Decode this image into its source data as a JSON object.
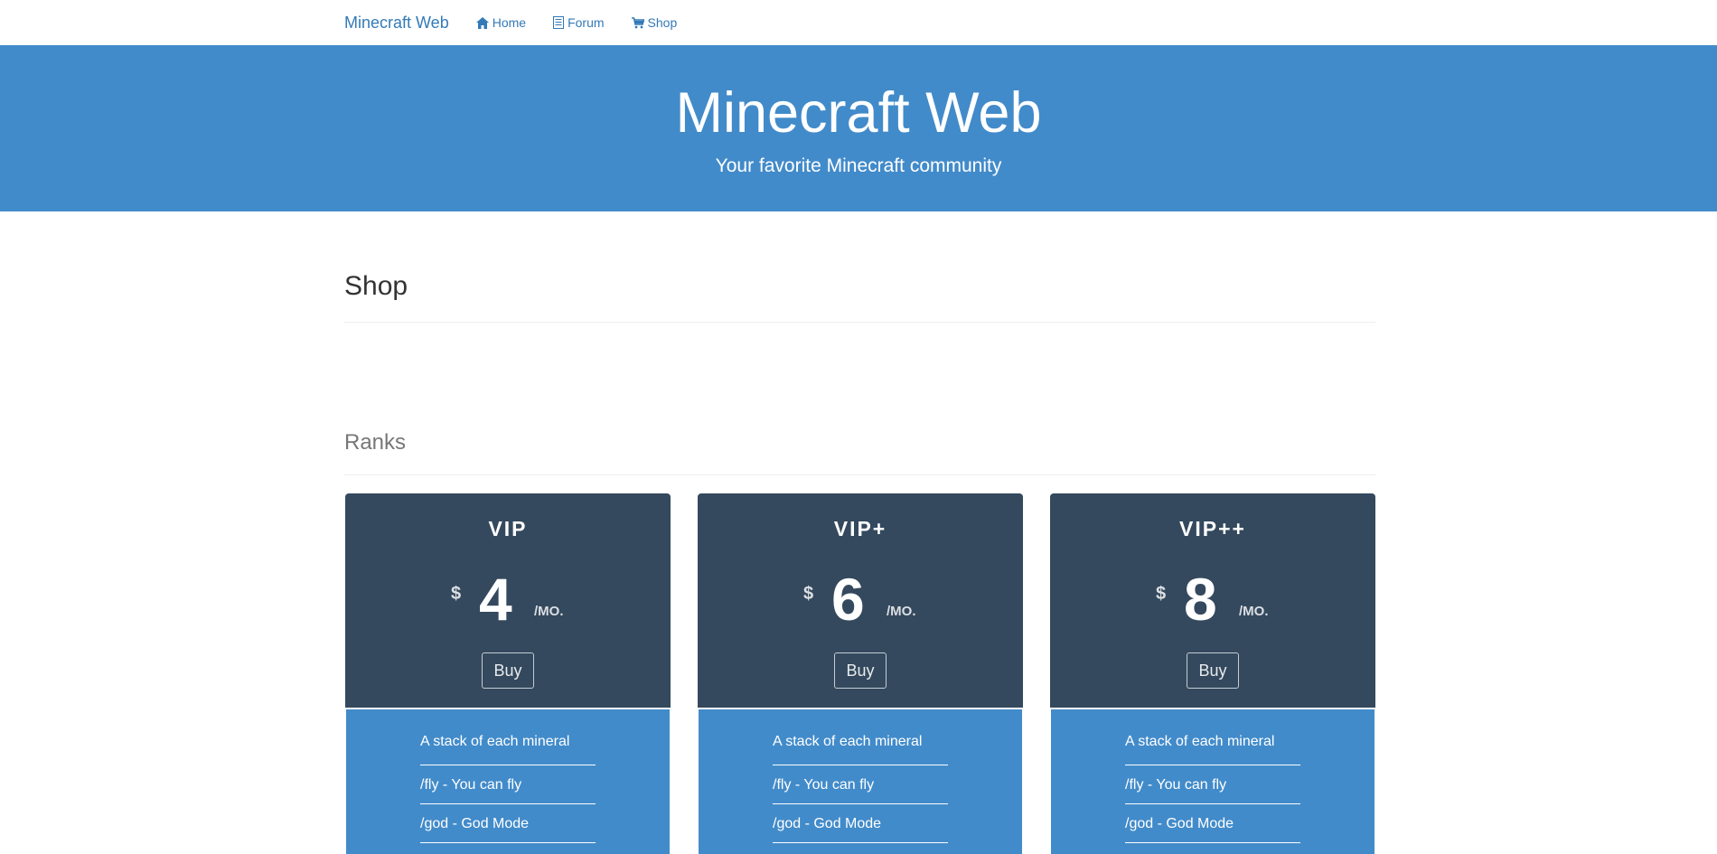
{
  "nav": {
    "brand": "Minecraft Web",
    "links": [
      {
        "label": "Home",
        "icon": "home-icon"
      },
      {
        "label": "Forum",
        "icon": "list-icon"
      },
      {
        "label": "Shop",
        "icon": "cart-icon"
      }
    ]
  },
  "hero": {
    "title": "Minecraft Web",
    "subtitle": "Your favorite Minecraft community"
  },
  "page": {
    "title": "Shop",
    "section_title": "Ranks"
  },
  "plans": [
    {
      "name": "VIP",
      "currency": "$",
      "amount": "4",
      "period": "/MO.",
      "button": "Buy",
      "features": [
        "A stack of each mineral",
        "/fly - You can fly",
        "/god - God Mode"
      ]
    },
    {
      "name": "VIP+",
      "currency": "$",
      "amount": "6",
      "period": "/MO.",
      "button": "Buy",
      "features": [
        "A stack of each mineral",
        "/fly - You can fly",
        "/god - God Mode"
      ]
    },
    {
      "name": "VIP++",
      "currency": "$",
      "amount": "8",
      "period": "/MO.",
      "button": "Buy",
      "features": [
        "A stack of each mineral",
        "/fly - You can fly",
        "/god - God Mode"
      ]
    }
  ],
  "colors": {
    "link": "#337ab7",
    "hero_bg": "#428bca",
    "card_head_bg": "#34495e",
    "card_body_bg": "#428bca"
  }
}
